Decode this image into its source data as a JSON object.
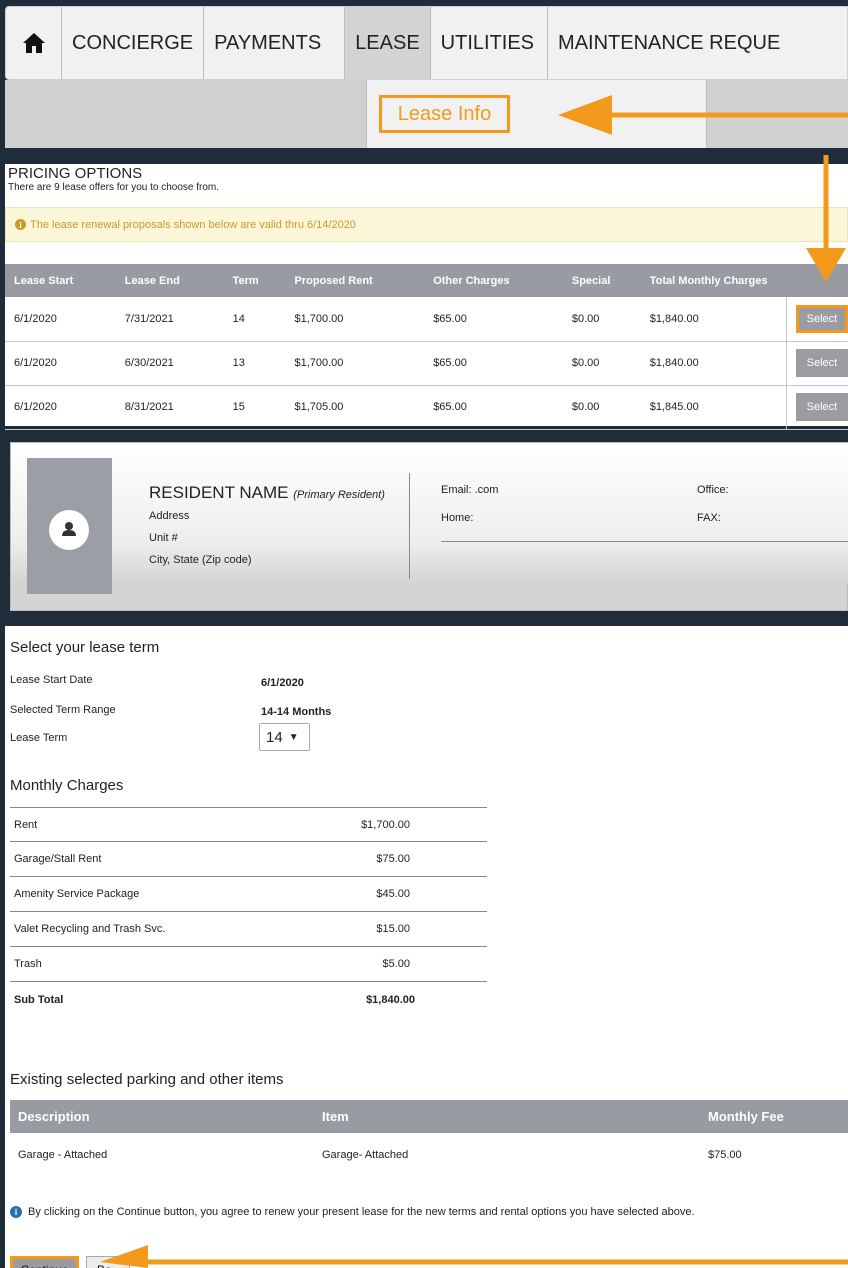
{
  "nav": {
    "home_icon": "home-icon",
    "items": [
      "CONCIERGE",
      "PAYMENTS",
      "LEASE",
      "UTILITIES",
      "MAINTENANCE REQUE"
    ],
    "active": "LEASE"
  },
  "subnav": {
    "lease_info": "Lease Info"
  },
  "pricing": {
    "title": "PRICING OPTIONS",
    "subtitle": "There are 9 lease offers for you to choose from.",
    "notice": "The lease renewal proposals shown below are valid thru 6/14/2020",
    "columns": [
      "Lease Start",
      "Lease End",
      "Term",
      "Proposed Rent",
      "Other Charges",
      "Special",
      "Total Monthly Charges"
    ],
    "rows": [
      [
        "6/1/2020",
        "7/31/2021",
        "14",
        "$1,700.00",
        "$65.00",
        "$0.00",
        "$1,840.00"
      ],
      [
        "6/1/2020",
        "6/30/2021",
        "13",
        "$1,700.00",
        "$65.00",
        "$0.00",
        "$1,840.00"
      ],
      [
        "6/1/2020",
        "8/31/2021",
        "15",
        "$1,705.00",
        "$65.00",
        "$0.00",
        "$1,845.00"
      ]
    ],
    "select_label": "Select"
  },
  "resident": {
    "name": "RESIDENT NAME",
    "role": "(Primary Resident)",
    "address": "Address",
    "unit": "Unit #",
    "city": "City, State (Zip code)",
    "email": "Email: .com",
    "home": "Home:",
    "office": "Office:",
    "fax": "FAX:"
  },
  "lease_term": {
    "heading": "Select your lease term",
    "start_label": "Lease Start Date",
    "start_value": "6/1/2020",
    "range_label": "Selected Term Range",
    "range_value": "14-14 Months",
    "term_label": "Lease Term",
    "term_value": "14"
  },
  "monthly": {
    "heading": "Monthly Charges",
    "rows": [
      [
        "Rent",
        "$1,700.00"
      ],
      [
        "Garage/Stall Rent",
        "$75.00"
      ],
      [
        "Amenity Service Package",
        "$45.00"
      ],
      [
        "Valet Recycling and Trash Svc.",
        "$15.00"
      ],
      [
        "Trash",
        "$5.00"
      ]
    ],
    "subtotal_label": "Sub Total",
    "subtotal_value": "$1,840.00"
  },
  "parking": {
    "heading": "Existing selected parking and other items",
    "columns": [
      "Description",
      "Item",
      "Monthly Fee"
    ],
    "rows": [
      [
        "Garage - Attached",
        "Garage- Attached",
        "$75.00"
      ]
    ]
  },
  "agreement": "By clicking on the Continue button, you agree to renew your present lease for the new terms and rental options you have selected above.",
  "buttons": {
    "continue": "Continue",
    "back": "Ba"
  },
  "colors": {
    "accent": "#f39a1c",
    "header_gray": "#989ba1",
    "page_bg": "#1f2d3b"
  }
}
